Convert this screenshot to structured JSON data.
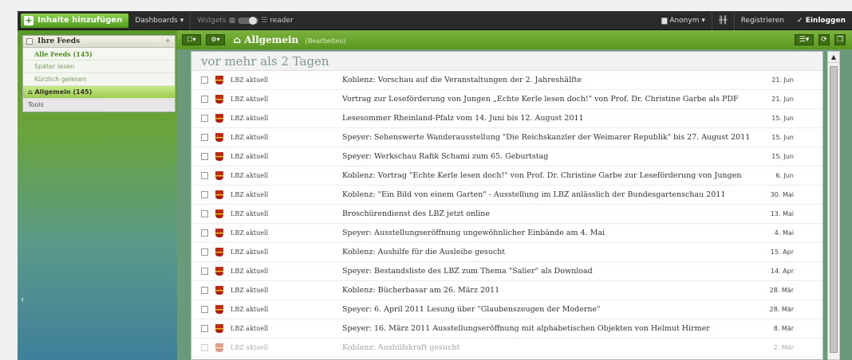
{
  "topbar": {
    "add_label": "Inhalte hinzufügen",
    "dashboards_label": "Dashboards ▾",
    "widgets_label": "Widgets",
    "reader_label": "reader",
    "anon_label": "Anonym ▾",
    "register_label": "Registrieren",
    "login_label": "✓ Einloggen"
  },
  "sidebar": {
    "header": "Ihre Feeds",
    "items": [
      {
        "label": "Alle Feeds (145)"
      },
      {
        "label": "Später lesen"
      },
      {
        "label": "Kürzlich gelesen"
      },
      {
        "label": "Allgemein (145)"
      },
      {
        "label": "Tools"
      }
    ]
  },
  "main": {
    "folder_title": "Allgemein",
    "folder_edit": "(Bearbeiten)",
    "section_heading": "vor mehr als 2 Tagen"
  },
  "items": [
    {
      "source": "LBZ aktuell",
      "title": "Koblenz: Vorschau auf die Veranstaltungen der 2. Jahreshälfte",
      "date": "21. Jun"
    },
    {
      "source": "LBZ aktuell",
      "title": "Vortrag zur Leseförderung von Jungen „Echte Kerle lesen doch!\" von Prof. Dr. Christine Garbe als PDF",
      "date": "21. Jun"
    },
    {
      "source": "LBZ aktuell",
      "title": "Lesesommer Rheinland-Pfalz vom 14. Juni bis 12. August 2011",
      "date": "15. Jun"
    },
    {
      "source": "LBZ aktuell",
      "title": "Speyer: Sehenswerte Wanderausstellung \"Die Reichskanzler der Weimarer Republik\" bis 27. August 2011",
      "date": "15. Jun"
    },
    {
      "source": "LBZ aktuell",
      "title": "Speyer: Werkschau Rafik Schami zum 65. Geburtstag",
      "date": "15. Jun"
    },
    {
      "source": "LBZ aktuell",
      "title": "Koblenz: Vortrag \"Echte Kerle lesen doch!\" von Prof. Dr. Christine Garbe zur Leseförderung von Jungen",
      "date": "6. Jun"
    },
    {
      "source": "LBZ aktuell",
      "title": "Koblenz: \"Ein Bild von einem Garten\" - Ausstellung im LBZ anlässlich der Bundesgartenschau 2011",
      "date": "30. Mai"
    },
    {
      "source": "LBZ aktuell",
      "title": "Broschürendienst des LBZ jetzt online",
      "date": "13. Mai"
    },
    {
      "source": "LBZ aktuell",
      "title": "Speyer: Ausstellungseröffnung ungewöhnlicher Einbände am 4. Mai",
      "date": "4. Mai"
    },
    {
      "source": "LBZ aktuell",
      "title": "Koblenz: Aushilfe für die Ausleihe gesucht",
      "date": "15. Apr"
    },
    {
      "source": "LBZ aktuell",
      "title": "Speyer: Bestandsliste des LBZ zum Thema \"Salier\" als Download",
      "date": "14. Apr"
    },
    {
      "source": "LBZ aktuell",
      "title": "Koblenz: Bücherbasar am 26. März 2011",
      "date": "28. Mär"
    },
    {
      "source": "LBZ aktuell",
      "title": "Speyer: 6. April 2011 Lesung über \"Glaubenszeugen der Moderne\"",
      "date": "28. Mär"
    },
    {
      "source": "LBZ aktuell",
      "title": "Speyer: 16. März 2011 Ausstellungseröffnung mit alphabetischen Objekten von Helmut Hirmer",
      "date": "8. Mär"
    },
    {
      "source": "LBZ aktuell",
      "title": "Koblenz: Aushilfskraft gesucht",
      "date": "2. Mär"
    }
  ]
}
